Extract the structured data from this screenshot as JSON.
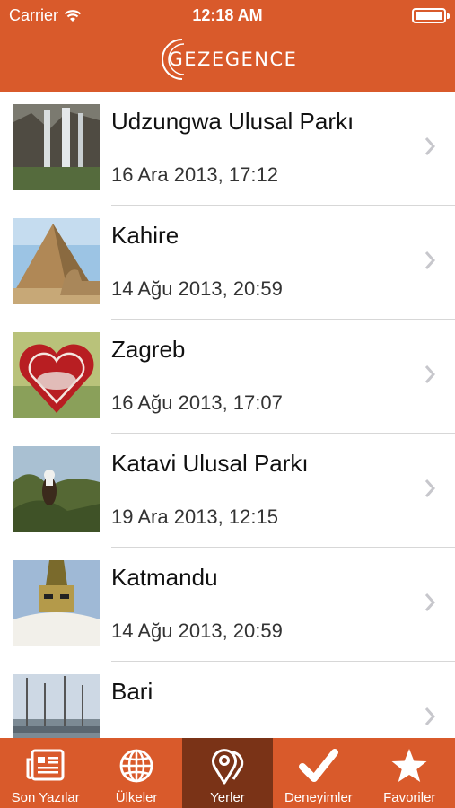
{
  "status_bar": {
    "carrier": "Carrier",
    "time": "12:18 AM"
  },
  "header": {
    "logo_text": "GEZEGENCE"
  },
  "colors": {
    "brand": "#d95a2b",
    "tab_active": "#7a3317",
    "separator": "#d7d7d7"
  },
  "places": [
    {
      "title": "Udzungwa Ulusal Parkı",
      "date": "16 Ara 2013, 17:12",
      "thumb": "waterfall"
    },
    {
      "title": "Kahire",
      "date": "14 Ağu 2013, 20:59",
      "thumb": "pyramid-sphinx"
    },
    {
      "title": "Zagreb",
      "date": "16 Ağu 2013, 17:07",
      "thumb": "gingerbread-heart"
    },
    {
      "title": "Katavi Ulusal Parkı",
      "date": "19 Ara 2013, 12:15",
      "thumb": "eagle-in-tree"
    },
    {
      "title": "Katmandu",
      "date": "14 Ağu 2013, 20:59",
      "thumb": "stupa"
    },
    {
      "title": "Bari",
      "date": "",
      "thumb": "harbor-masts"
    }
  ],
  "tabs": [
    {
      "label": "Son Yazılar",
      "icon": "newspaper-icon",
      "active": false
    },
    {
      "label": "Ülkeler",
      "icon": "globe-icon",
      "active": false
    },
    {
      "label": "Yerler",
      "icon": "map-pin-icon",
      "active": true
    },
    {
      "label": "Deneyimler",
      "icon": "checkmark-icon",
      "active": false
    },
    {
      "label": "Favoriler",
      "icon": "star-icon",
      "active": false
    }
  ]
}
